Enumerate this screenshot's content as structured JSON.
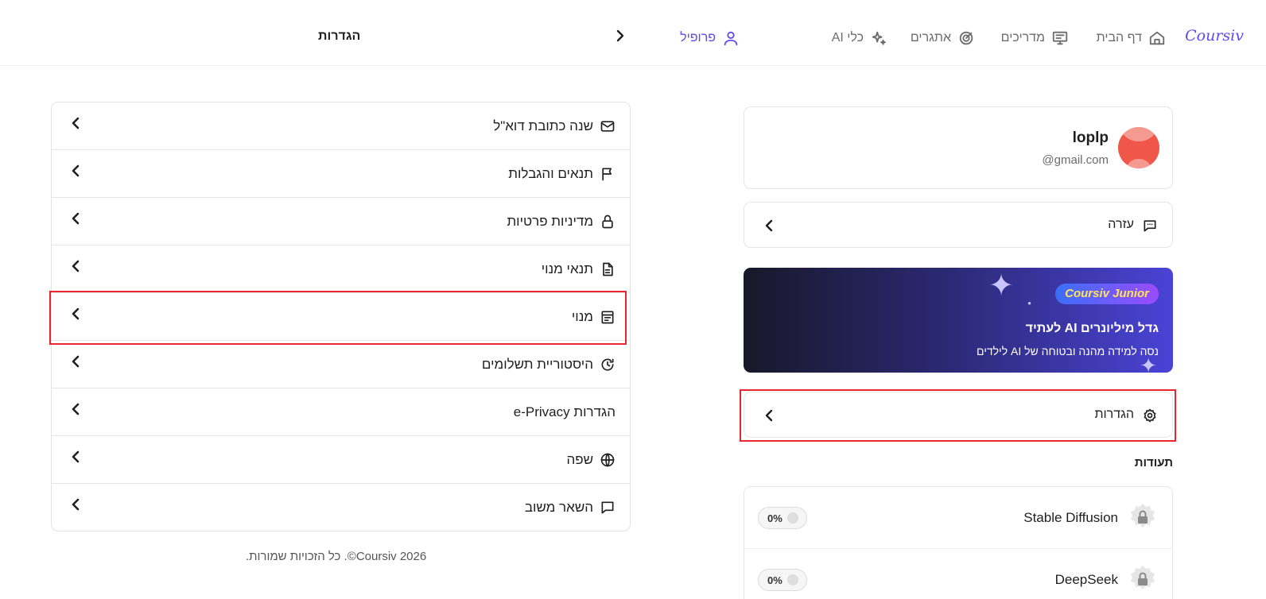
{
  "nav": {
    "logo": "Coursiv",
    "items": [
      {
        "label": "דף הבית"
      },
      {
        "label": "מדריכים"
      },
      {
        "label": "אתגרים"
      },
      {
        "label": "כלי AI"
      }
    ],
    "profile": "פרופיל",
    "page_title": "הגדרות"
  },
  "profile": {
    "name": "loplp",
    "email": "@gmail.com"
  },
  "help": {
    "label": "עזרה"
  },
  "banner": {
    "badge": "Coursiv Junior",
    "title": "גדל מיליונרים AI לעתיד",
    "subtitle": "נסה למידה מהנה ובטוחה של AI לילדים"
  },
  "settings_entry": {
    "label": "הגדרות"
  },
  "certificates": {
    "title": "תעודות",
    "items": [
      {
        "name": "Stable Diffusion",
        "progress": "0%"
      },
      {
        "name": "DeepSeek",
        "progress": "0%"
      }
    ]
  },
  "settings_list": [
    {
      "label": "שנה כתובת דוא\"ל",
      "icon": "mail-icon"
    },
    {
      "label": "תנאים והגבלות",
      "icon": "flag-icon"
    },
    {
      "label": "מדיניות פרטיות",
      "icon": "lock-icon"
    },
    {
      "label": "תנאי מנוי",
      "icon": "document-icon"
    },
    {
      "label": "מנוי",
      "icon": "subscription-icon"
    },
    {
      "label": "היסטוריית תשלומים",
      "icon": "history-icon"
    },
    {
      "label": "הגדרות e-Privacy",
      "icon": "privacy-icon"
    },
    {
      "label": "שפה",
      "icon": "globe-icon"
    },
    {
      "label": "השאר משוב",
      "icon": "feedback-icon"
    }
  ],
  "footer": "Coursiv 2026©. כל הזכויות שמורות.",
  "colors": {
    "accent": "#5b4bf0",
    "highlight": "#e8262d"
  }
}
